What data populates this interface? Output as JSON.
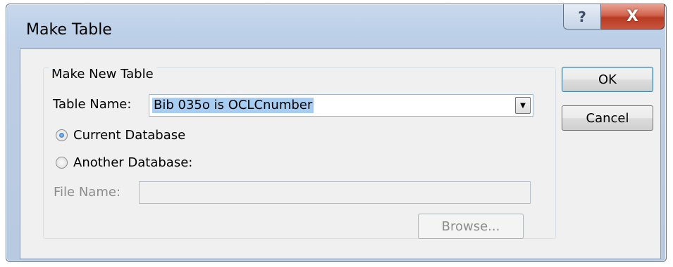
{
  "window": {
    "title": "Make Table",
    "help_glyph": "?",
    "close_glyph": "X"
  },
  "group": {
    "label": "Make New Table"
  },
  "table_name": {
    "label": "Table Name:",
    "value": "Bib 035o is OCLCnumber"
  },
  "options": {
    "current_database": "Current Database",
    "another_database": "Another Database:",
    "selected": "current_database"
  },
  "file_name": {
    "label": "File Name:",
    "value": ""
  },
  "buttons": {
    "ok": "OK",
    "cancel": "Cancel",
    "browse": "Browse..."
  },
  "icons": {
    "dropdown": "▼",
    "help": "question-icon",
    "close": "close-icon"
  }
}
